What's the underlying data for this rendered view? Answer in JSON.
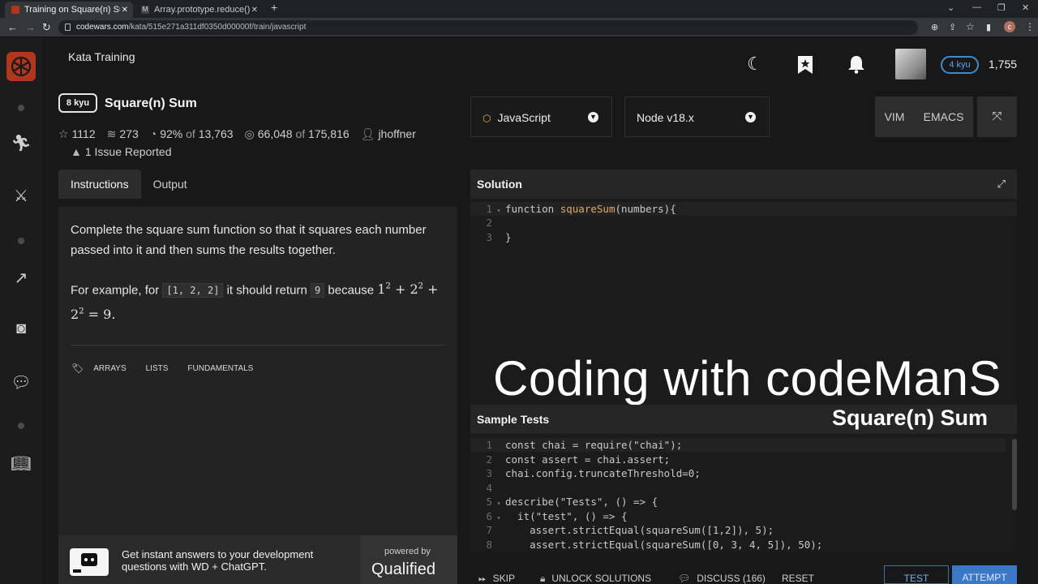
{
  "browser": {
    "tabs": [
      {
        "label": "Training on Square(n) Sum | Codewars",
        "active": true
      },
      {
        "label": "Array.prototype.reduce() - JavaScript",
        "active": false
      }
    ],
    "url_host": "codewars.com",
    "url_path": "/kata/515e271a311df0350d00000f/train/javascript",
    "profile_initial": "c"
  },
  "header": {
    "section_title": "Kata Training",
    "rank": "4 kyu",
    "honor": "1,755"
  },
  "kata": {
    "kyu": "8 kyu",
    "title": "Square(n) Sum",
    "stats": {
      "stars": "1112",
      "collections": "273",
      "satisfaction": "92%",
      "satisfaction_of": "of",
      "votes": "13,763",
      "completed": "66,048",
      "completed_of": "of",
      "attempts": "175,816",
      "author": "jhoffner"
    },
    "issues": "1 Issue Reported"
  },
  "tabs": {
    "instructions": "Instructions",
    "output": "Output"
  },
  "instructions": {
    "paragraph1": "Complete the square sum function so that it squares each number passed into it and then sums the results together.",
    "example_prefix": "For example, for",
    "example_input": "[1, 2, 2]",
    "example_mid": "it should return",
    "example_output": "9",
    "example_because": "because",
    "math_line1": "1",
    "math_line2": "2",
    "math_line3": "+ 2",
    "math_result": "= 9.",
    "math_exp": "2",
    "tags": [
      "ARRAYS",
      "LISTS",
      "FUNDAMENTALS"
    ]
  },
  "ad": {
    "text": "Get instant answers to your development questions with WD + ChatGPT.",
    "powered_by": "powered by",
    "brand": "Qualified"
  },
  "editor": {
    "language": "JavaScript",
    "runtime": "Node v18.x",
    "keymaps": [
      "VIM",
      "EMACS"
    ],
    "solution_title": "Solution",
    "solution_lines": [
      {
        "n": "1",
        "fold": "▾",
        "kw": "function ",
        "fn": "squareSum",
        "rest": "(numbers){"
      },
      {
        "n": "2",
        "fold": "",
        "kw": "",
        "fn": "",
        "rest": ""
      },
      {
        "n": "3",
        "fold": "",
        "kw": "",
        "fn": "",
        "rest": "}"
      }
    ],
    "tests_title": "Sample Tests",
    "test_lines": [
      {
        "n": "1",
        "fold": "",
        "text": "const chai = require(\"chai\");"
      },
      {
        "n": "2",
        "fold": "",
        "text": "const assert = chai.assert;"
      },
      {
        "n": "3",
        "fold": "",
        "text": "chai.config.truncateThreshold=0;"
      },
      {
        "n": "4",
        "fold": "",
        "text": ""
      },
      {
        "n": "5",
        "fold": "▾",
        "text": "describe(\"Tests\", () => {"
      },
      {
        "n": "6",
        "fold": "▾",
        "text": "  it(\"test\", () => {"
      },
      {
        "n": "7",
        "fold": "",
        "text": "    assert.strictEqual(squareSum([1,2]), 5);"
      },
      {
        "n": "8",
        "fold": "",
        "text": "    assert.strictEqual(squareSum([0, 3, 4, 5]), 50);"
      }
    ]
  },
  "overlay": {
    "title": "Coding with codeManS",
    "subtitle": "Square(n) Sum"
  },
  "actions": {
    "skip": "SKIP",
    "unlock": "UNLOCK SOLUTIONS",
    "discuss": "DISCUSS (166)",
    "reset": "RESET",
    "test": "TEST",
    "attempt": "ATTEMPT"
  },
  "colors": {
    "brand": "#b1361e",
    "rank_blue": "#3d8bd1",
    "attempt_blue": "#3c78c8"
  }
}
